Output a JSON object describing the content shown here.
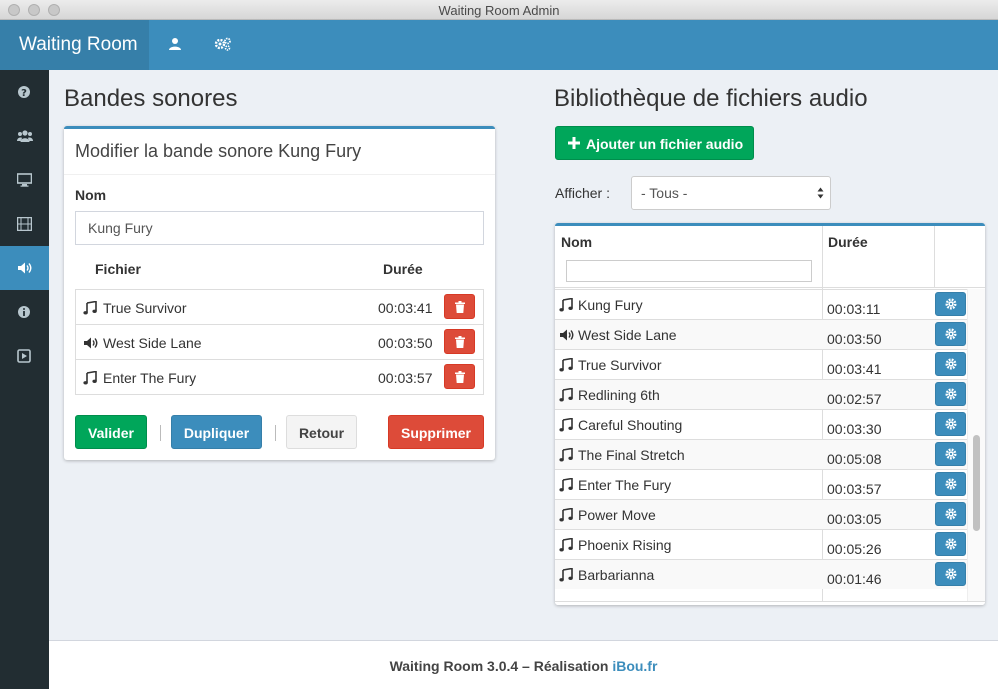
{
  "window": {
    "title": "Waiting Room Admin"
  },
  "navbar": {
    "brand": "Waiting Room",
    "icons": [
      "user-icon",
      "cogs-icon"
    ]
  },
  "sidebar": {
    "items": [
      {
        "icon": "question-circle-icon"
      },
      {
        "icon": "users-icon"
      },
      {
        "icon": "desktop-icon"
      },
      {
        "icon": "film-icon"
      },
      {
        "icon": "volume-icon",
        "active": true
      },
      {
        "icon": "info-circle-icon"
      },
      {
        "icon": "play-square-icon"
      }
    ]
  },
  "left": {
    "heading": "Bandes sonores",
    "panel": {
      "title": "Modifier la bande sonore Kung Fury",
      "name_label": "Nom",
      "name_value": "Kung Fury",
      "file_col": "Fichier",
      "duration_col": "Durée",
      "files": [
        {
          "icon": "music-icon",
          "name": "True Survivor",
          "duration": "00:03:41"
        },
        {
          "icon": "volume-icon",
          "name": "West Side Lane",
          "duration": "00:03:50"
        },
        {
          "icon": "music-icon",
          "name": "Enter The Fury",
          "duration": "00:03:57"
        }
      ],
      "buttons": {
        "validate": "Valider",
        "duplicate": "Dupliquer",
        "back": "Retour",
        "delete": "Supprimer"
      }
    }
  },
  "right": {
    "heading": "Bibliothèque de fichiers audio",
    "add_button": "Ajouter un fichier audio",
    "filter_label": "Afficher :",
    "filter_value": "- Tous -",
    "table": {
      "col_name": "Nom",
      "col_duration": "Durée",
      "rows": [
        {
          "icon": "music-icon",
          "name": "Kung Fury",
          "duration": "00:03:11"
        },
        {
          "icon": "volume-icon",
          "name": "West Side Lane",
          "duration": "00:03:50"
        },
        {
          "icon": "music-icon",
          "name": "True Survivor",
          "duration": "00:03:41"
        },
        {
          "icon": "music-icon",
          "name": "Redlining 6th",
          "duration": "00:02:57"
        },
        {
          "icon": "music-icon",
          "name": "Careful Shouting",
          "duration": "00:03:30"
        },
        {
          "icon": "music-icon",
          "name": "The Final Stretch",
          "duration": "00:05:08"
        },
        {
          "icon": "music-icon",
          "name": "Enter The Fury",
          "duration": "00:03:57"
        },
        {
          "icon": "music-icon",
          "name": "Power Move",
          "duration": "00:03:05"
        },
        {
          "icon": "music-icon",
          "name": "Phoenix Rising",
          "duration": "00:05:26"
        },
        {
          "icon": "music-icon",
          "name": "Barbarianna",
          "duration": "00:01:46"
        }
      ]
    }
  },
  "footer": {
    "text": "Waiting Room 3.0.4 – Réalisation",
    "link": "iBou.fr"
  },
  "colors": {
    "primary": "#3c8dbc",
    "success": "#00a65a",
    "danger": "#dd4b39",
    "sidebar": "#222d32"
  }
}
